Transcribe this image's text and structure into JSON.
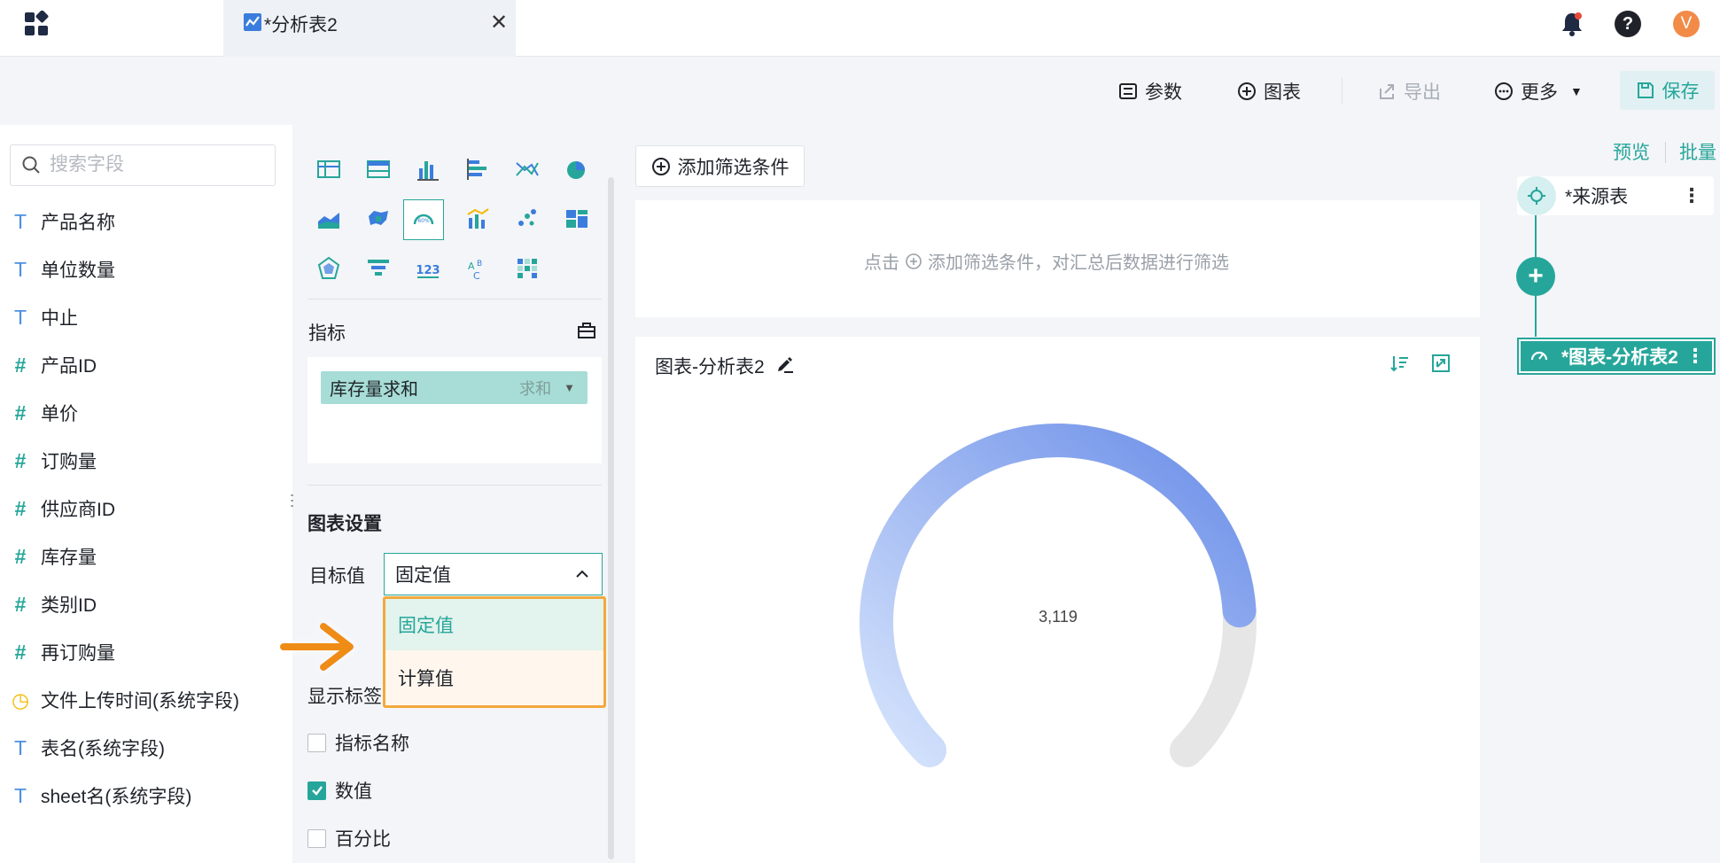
{
  "tab": {
    "title": "*分析表2",
    "close_glyph": "✕"
  },
  "header": {
    "help_glyph": "?",
    "avatar_initial": "V"
  },
  "toolbar": {
    "params_label": "参数",
    "chart_label": "图表",
    "export_label": "导出",
    "more_label": "更多",
    "save_label": "保存"
  },
  "fields": {
    "search_placeholder": "搜索字段",
    "items": [
      {
        "type": "T",
        "name": "产品名称"
      },
      {
        "type": "T",
        "name": "单位数量"
      },
      {
        "type": "T",
        "name": "中止"
      },
      {
        "type": "#",
        "name": "产品ID"
      },
      {
        "type": "#",
        "name": "单价"
      },
      {
        "type": "#",
        "name": "订购量"
      },
      {
        "type": "#",
        "name": "供应商ID"
      },
      {
        "type": "#",
        "name": "库存量"
      },
      {
        "type": "#",
        "name": "类别ID"
      },
      {
        "type": "#",
        "name": "再订购量"
      },
      {
        "type": "◷",
        "name": "文件上传时间(系统字段)"
      },
      {
        "type": "T",
        "name": "表名(系统字段)"
      },
      {
        "type": "T",
        "name": "sheet名(系统字段)"
      }
    ]
  },
  "config": {
    "metric_title": "指标",
    "metric_pill": {
      "name": "库存量求和",
      "agg": "求和",
      "arrow": "▼"
    },
    "chart_settings_title": "图表设置",
    "target_label": "目标值",
    "target_value": "固定值",
    "dropdown_options": [
      "固定值",
      "计算值"
    ],
    "show_label_title": "显示标签",
    "checkboxes": [
      {
        "label": "指标名称",
        "checked": false
      },
      {
        "label": "数值",
        "checked": true
      },
      {
        "label": "百分比",
        "checked": false
      }
    ]
  },
  "filter": {
    "add_button_label": "添加筛选条件",
    "hint_prefix": "点击",
    "hint_suffix": "添加筛选条件，对汇总后数据进行筛选"
  },
  "chart": {
    "title": "图表-分析表2",
    "value_label": "3,119"
  },
  "chart_data": {
    "type": "gauge",
    "value": 3119,
    "value_label": "3,119",
    "fill_fraction": 0.82,
    "colors": {
      "start": "#d6e4fc",
      "end": "#6b8ee8",
      "track": "#e6e6e6"
    }
  },
  "flow": {
    "preview_label": "预览",
    "batch_label": "批量",
    "source_node": "*来源表",
    "chart_node": "*图表-分析表2",
    "more_glyph": "⋮",
    "add_glyph": "+"
  },
  "colors": {
    "accent": "#26a69a",
    "highlight": "#f2a93b"
  }
}
